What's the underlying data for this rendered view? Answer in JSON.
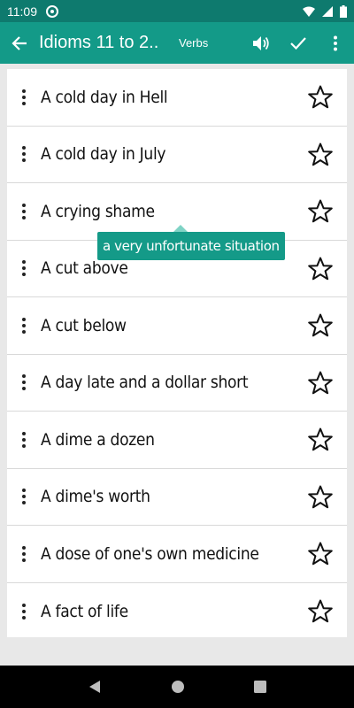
{
  "status_bar": {
    "time": "11:09"
  },
  "app_bar": {
    "title": "Idioms 11 to 2..",
    "subtitle": "Verbs",
    "icons": [
      "arrow-back-icon",
      "volume-icon",
      "check-icon",
      "more-vert-icon"
    ]
  },
  "list": {
    "items": [
      {
        "label": "A cold day in Hell"
      },
      {
        "label": "A cold day in July"
      },
      {
        "label": "A crying shame"
      },
      {
        "label": "A cut above"
      },
      {
        "label": "A cut below"
      },
      {
        "label": "A day late and a dollar short"
      },
      {
        "label": "A dime a dozen"
      },
      {
        "label": "A dime's worth"
      },
      {
        "label": "A dose of one's own medicine"
      },
      {
        "label": "A fact of life"
      }
    ]
  },
  "tooltip": {
    "text": "a very unfortunate situation"
  },
  "colors": {
    "app_bar": "#139a88",
    "status_bar": "#0e7a6e",
    "tooltip": "#149a88"
  }
}
